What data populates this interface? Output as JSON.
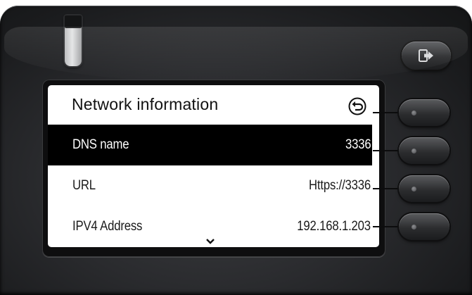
{
  "screen": {
    "title": "Network information",
    "back_icon": "back-arrow-icon",
    "rows": [
      {
        "label": "DNS name",
        "value": "3336",
        "selected": true
      },
      {
        "label": "URL",
        "value": "Https://3336",
        "selected": false
      },
      {
        "label": "IPV4 Address",
        "value": "192.168.1.203",
        "selected": false
      }
    ],
    "scroll_indicator": "chevron-down-icon"
  },
  "hardware": {
    "exit_key_icon": "exit-icon",
    "softkey_icon": "dot-icon"
  },
  "colors": {
    "housing": "#2a2b2e",
    "selected_row_bg": "#000000",
    "selected_row_text": "#ffffff",
    "screen_bg": "#ffffff"
  }
}
